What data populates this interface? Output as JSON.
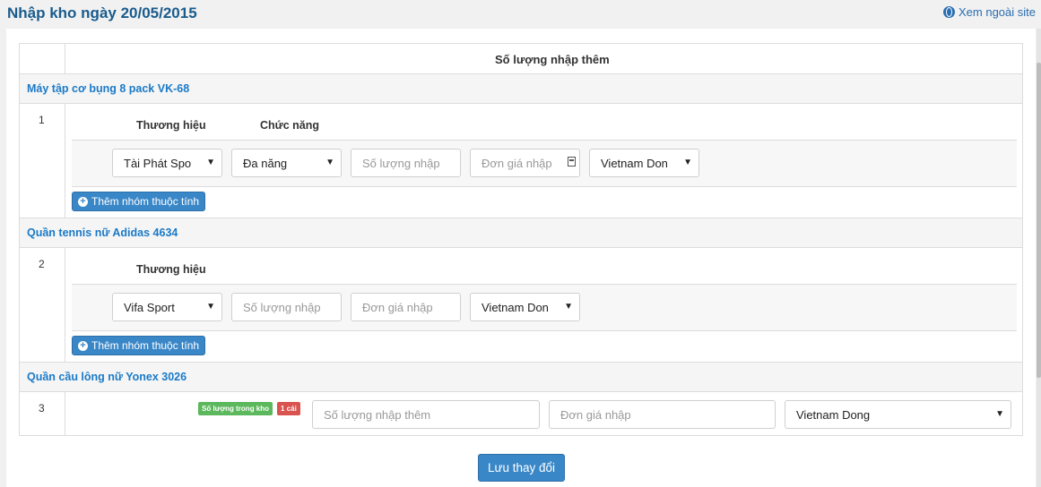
{
  "header": {
    "title": "Nhập kho ngày 20/05/2015",
    "ext_link": "Xem ngoài site"
  },
  "table": {
    "col_header": "Số lượng nhập thêm"
  },
  "products": [
    {
      "name": "Máy tập cơ bụng 8 pack VK-68",
      "index": "1",
      "attr_labels": [
        "Thương hiệu",
        "Chức năng"
      ],
      "brand": "Tài Phát Spo",
      "function": "Đa năng",
      "qty_placeholder": "Số lượng nhập",
      "price_placeholder": "Đơn giá nhập",
      "currency": "Vietnam Don",
      "add_group_label": "Thêm nhóm thuộc tính"
    },
    {
      "name": "Quần tennis nữ Adidas 4634",
      "index": "2",
      "attr_labels": [
        "Thương hiệu"
      ],
      "brand": "Vifa Sport",
      "qty_placeholder": "Số lượng nhập",
      "price_placeholder": "Đơn giá nhập",
      "currency": "Vietnam Don",
      "add_group_label": "Thêm nhóm thuộc tính"
    },
    {
      "name": "Quần cầu lông nữ Yonex 3026",
      "index": "3",
      "stock_label": "Số lượng trong kho",
      "stock_value": "1 cái",
      "qty_placeholder": "Số lượng nhập thêm",
      "price_placeholder": "Đơn giá nhập",
      "currency": "Vietnam Dong"
    }
  ],
  "save_label": "Lưu thay đổi",
  "colors": {
    "title": "#1a5b8c",
    "product_link": "#1b7ac7",
    "primary_button": "#3a87c8",
    "success_badge": "#5cb85c",
    "danger_badge": "#d9534f"
  },
  "icons": {
    "ext_link": "globe-icon",
    "add": "plus-circle-icon",
    "select": "caret-down-icon",
    "date": "calendar-icon"
  }
}
